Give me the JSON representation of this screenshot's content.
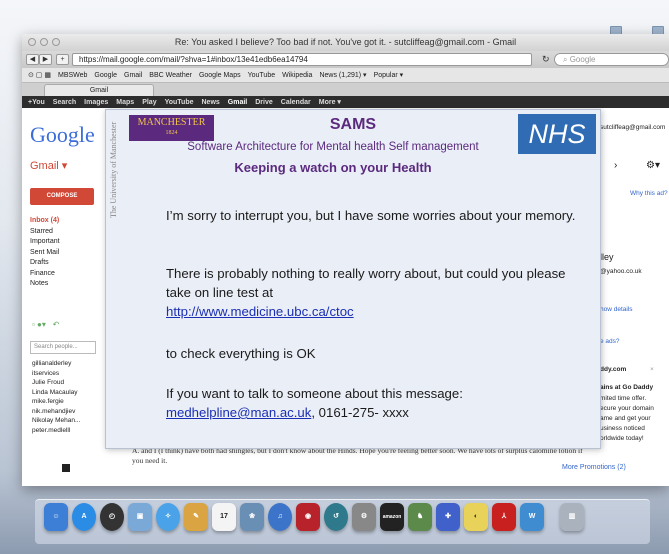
{
  "browser": {
    "title": "Re: You asked I believe? Too bad if not. You've got it. - sutcliffeag@gmail.com - Gmail",
    "url": "https://mail.google.com/mail/?shva=1#inbox/13e41edb6ea14794",
    "search_placeholder": "Google",
    "bookmarks": [
      "MBSWeb",
      "Google",
      "Gmail",
      "BBC Weather",
      "Google Maps",
      "YouTube",
      "Wikipedia",
      "News (1,291) ▾",
      "Popular ▾"
    ],
    "tab": "Gmail"
  },
  "gmail": {
    "topbar": [
      "+You",
      "Search",
      "Images",
      "Maps",
      "Play",
      "YouTube",
      "News",
      "Gmail",
      "Drive",
      "Calendar",
      "More ▾"
    ],
    "logo": "Google",
    "label": "Gmail ▾",
    "compose": "COMPOSE",
    "folders": [
      "Inbox (4)",
      "Starred",
      "Important",
      "Sent Mail",
      "Drafts",
      "Finance",
      "Notes"
    ],
    "people_search_placeholder": "Search people...",
    "contacts": [
      "gillianalderley",
      "itservices",
      "Julie Froud",
      "Linda Macaulay",
      "mike.fergie",
      "nik.mehandjiev",
      "Nikolay Mehan...",
      "peter.medlelll"
    ],
    "right": {
      "account": "sutcliffeag@gmail.com",
      "why_ad": "Why this ad?",
      "contact_name": "lley",
      "contact_email": "@yahoo.co.uk",
      "show_details": "how details",
      "see_ads": "e ads?",
      "ad_domain": "ddy.com",
      "ad_lines": [
        "ains at Go Daddy",
        "mited time offer.",
        "ecure your domain",
        "ame and get your",
        "usiness noticed",
        "orldwide today!"
      ]
    },
    "email_snippet": "A. and I (I think) have both had shingles, but I don't know about the Hinds. Hope you're feeling better soon. We have lots of surplus calomine lotion if you need it.",
    "more_promotions": "More Promotions (2)"
  },
  "sams": {
    "uni_vertical": "The University of Manchester",
    "manchester": "MANCHESTER",
    "manchester_year": "1824",
    "nhs": "NHS",
    "title": "SAMS",
    "subtitle": "Software Architecture for Mental health Self management",
    "watch": "Keeping a watch on your Health",
    "p1": "I’m sorry to interrupt you, but I have some worries about your memory.",
    "p2": "There is probably nothing to really worry about, but could you please take on line test at",
    "test_link": "http://www.medicine.ubc.ca/ctoc",
    "p3": "to check everything is OK",
    "p4": "If you  want to talk to someone about this message:",
    "email_link": "medhelpline@man.ac.uk",
    "phone": ", 0161-275- xxxx"
  },
  "dock": {
    "items": [
      "finder-icon",
      "app-store-icon",
      "dashboard-icon",
      "preview-icon",
      "safari-icon",
      "notes-icon",
      "calendar-icon",
      "photo-icon",
      "itunes-icon",
      "photobooth-icon",
      "time-machine-icon",
      "system-preferences-icon",
      "amazon-icon",
      "chess-icon",
      "puzzle-icon",
      "mouse-icon",
      "acrobat-icon",
      "word-icon",
      "trash-icon"
    ],
    "amazon_label": "amazon",
    "calendar_day": "17"
  },
  "colors": {
    "sams_purple": "#5b2a7f",
    "nhs_blue": "#2f6cb4",
    "gmail_red": "#d14836",
    "link_blue": "#1a2fb3"
  }
}
